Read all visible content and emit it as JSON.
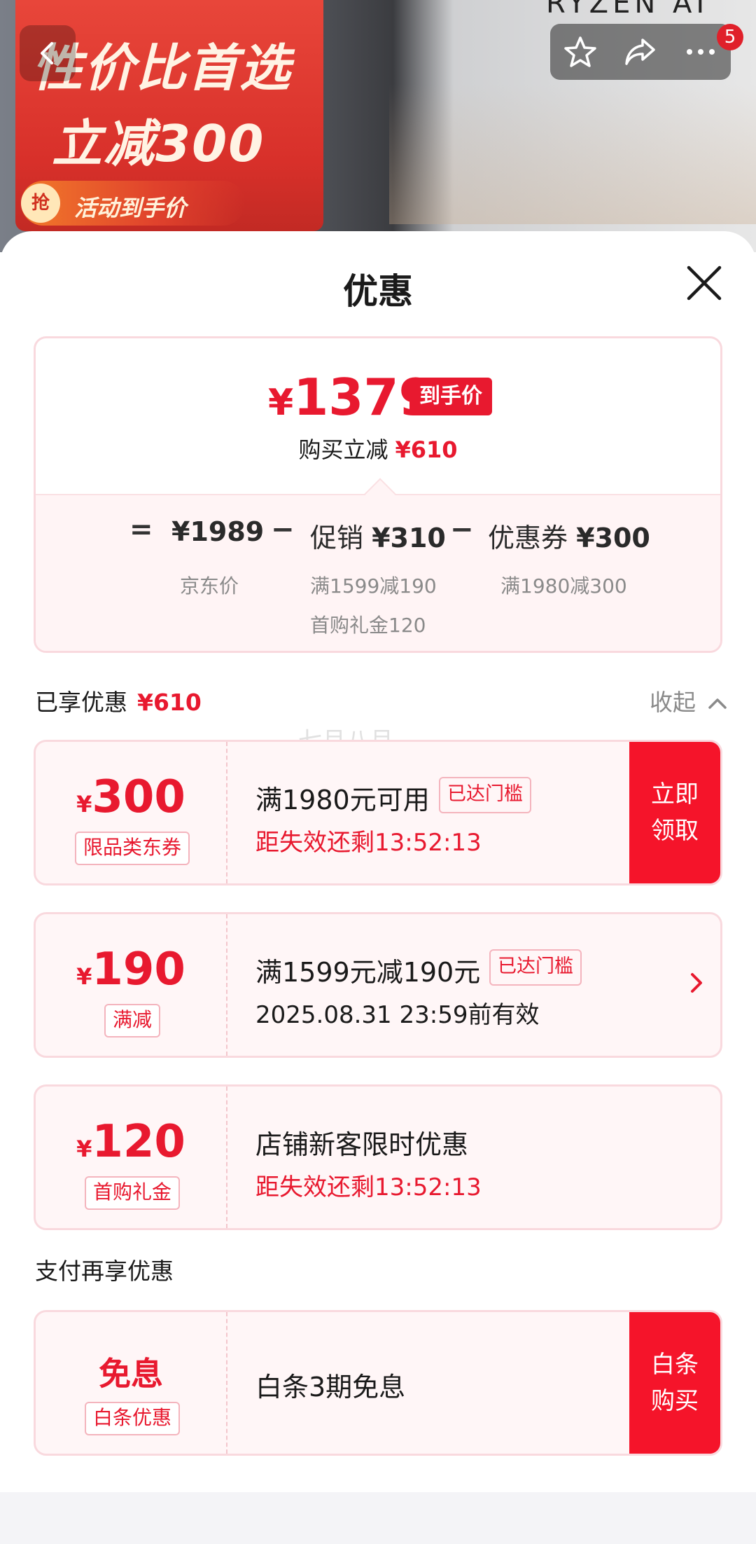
{
  "banner": {
    "promo_line1": "性价比首选",
    "promo_line2": "立减300",
    "promo_pill_badge": "抢",
    "promo_pill_text": "活动到手价",
    "brand_text": "RYZEN AI",
    "cart_badge": "5"
  },
  "sheet": {
    "title": "优惠"
  },
  "summary": {
    "final_price_symbol": "¥",
    "final_price": "1379",
    "price_tag": "到手价",
    "save_label": "购买立减",
    "save_amount": "¥610",
    "equals": "=",
    "minus": "−",
    "jd_price": "¥1989",
    "jd_price_label": "京东价",
    "promo_label": "促销",
    "promo_amount": "¥310",
    "promo_detail_1": "满1599减190",
    "promo_detail_2": "首购礼金120",
    "coupon_label": "优惠券",
    "coupon_amount": "¥300",
    "coupon_detail": "满1980减300"
  },
  "enjoyed": {
    "label": "已享优惠",
    "amount": "¥610",
    "collapse_label": "收起",
    "watermark": "七月八月"
  },
  "coupons": [
    {
      "symbol": "¥",
      "amount": "300",
      "kind": "限品类东券",
      "title": "满1980元可用",
      "reached": "已达门槛",
      "sub": "距失效还剩13:52:13",
      "action_line1": "立即",
      "action_line2": "领取"
    },
    {
      "symbol": "¥",
      "amount": "190",
      "kind": "满减",
      "title": "满1599元减190元",
      "reached": "已达门槛",
      "sub": "2025.08.31 23:59前有效"
    },
    {
      "symbol": "¥",
      "amount": "120",
      "kind": "首购礼金",
      "title": "店铺新客限时优惠",
      "sub": "距失效还剩13:52:13"
    }
  ],
  "payment": {
    "label": "支付再享优惠",
    "free_title": "免息",
    "free_kind": "白条优惠",
    "title": "白条3期免息",
    "action_line1": "白条",
    "action_line2": "购买"
  },
  "colors": {
    "accent_red": "#e8192f",
    "card_border": "#f9d9de",
    "card_bg": "#fff6f7"
  }
}
